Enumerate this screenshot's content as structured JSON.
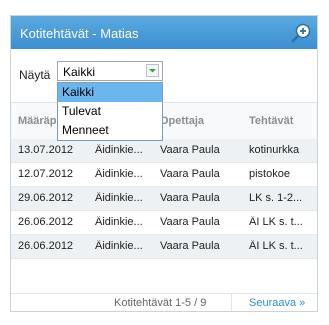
{
  "window": {
    "title": "Kotitehtävät - Matias"
  },
  "filter": {
    "label": "Näytä",
    "selected": "Kaikki",
    "options": [
      "Kaikki",
      "Tulevat",
      "Menneet"
    ]
  },
  "table": {
    "columns": [
      "Määräp",
      "",
      "Opettaja",
      "Tehtävät"
    ],
    "rows": [
      [
        "13.07.2012",
        "Äidinkie...",
        "Vaara Paula",
        "kotinurkka"
      ],
      [
        "12.07.2012",
        "Äidinkie...",
        "Vaara Paula",
        "pistokoe"
      ],
      [
        "29.06.2012",
        "Äidinkie...",
        "Vaara Paula",
        "LK s. 1-2..."
      ],
      [
        "26.06.2012",
        "Äidinkie...",
        "Vaara Paula",
        "ÄI LK s. t..."
      ],
      [
        "26.06.2012",
        "Äidinkie...",
        "Vaara Paula",
        "ÄI LK s. t..."
      ]
    ]
  },
  "footer": {
    "count": "Kotitehtävät 1-5 / 9",
    "next": "Seuraava »"
  },
  "colors": {
    "header": "#3b8fd1",
    "selected_option": "#6cb6f0",
    "link": "#2e8fd8"
  },
  "icons": {
    "header": "zoom-in-icon",
    "dropdown": "chevron-down-icon"
  }
}
